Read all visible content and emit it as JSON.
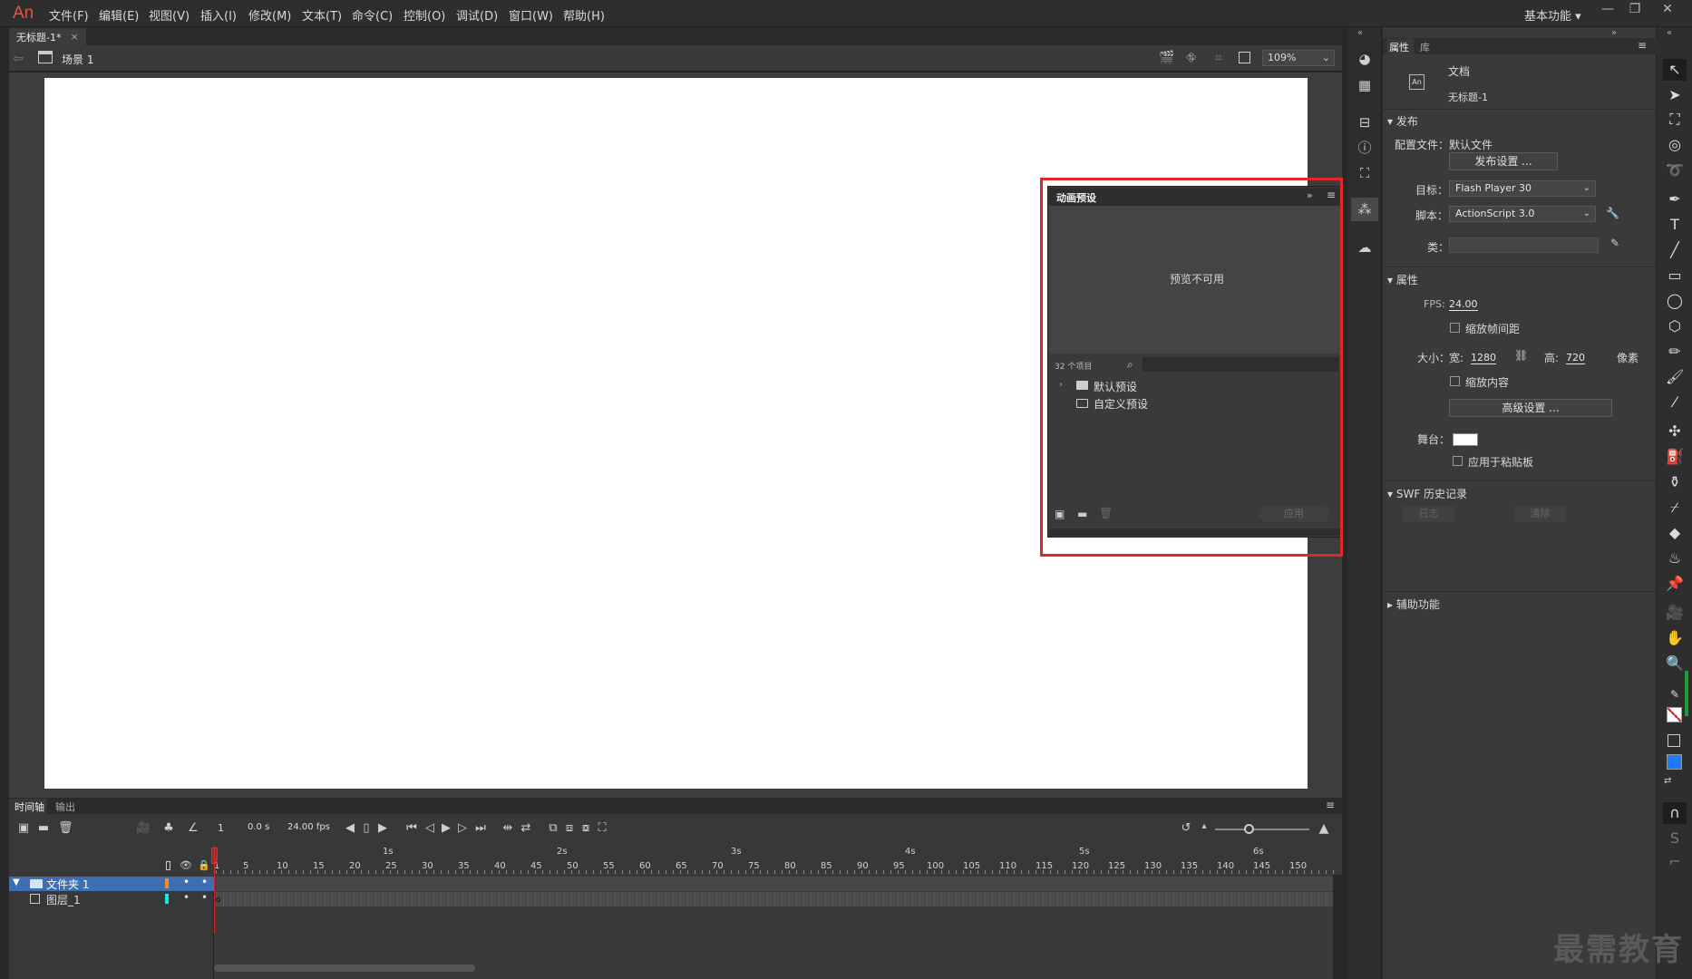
{
  "app": {
    "logo": "An",
    "workspace": "基本功能 ▾"
  },
  "menu": [
    {
      "id": "file",
      "label": "文件(F)"
    },
    {
      "id": "edit",
      "label": "编辑(E)"
    },
    {
      "id": "view",
      "label": "视图(V)"
    },
    {
      "id": "insert",
      "label": "插入(I)"
    },
    {
      "id": "modify",
      "label": "修改(M)"
    },
    {
      "id": "text",
      "label": "文本(T)"
    },
    {
      "id": "commands",
      "label": "命令(C)"
    },
    {
      "id": "control",
      "label": "控制(O)"
    },
    {
      "id": "debug",
      "label": "调试(D)"
    },
    {
      "id": "window",
      "label": "窗口(W)"
    },
    {
      "id": "help",
      "label": "帮助(H)"
    }
  ],
  "document": {
    "tab_title": "无标题-1*",
    "close": "×"
  },
  "scene": {
    "label": "场景 1",
    "zoom": "109%"
  },
  "preset_panel": {
    "title": "动画预设",
    "preview_text": "预览不可用",
    "count": "32 个项目",
    "folders": [
      "默认预设",
      "自定义预设"
    ],
    "apply": "应用"
  },
  "properties": {
    "tab_props": "属性",
    "tab_library": "库",
    "doc_type": "文档",
    "doc_name": "无标题-1",
    "publish": {
      "header": "发布",
      "profile_label": "配置文件：",
      "profile_value": "默认文件",
      "settings_button": "发布设置 ...",
      "target_label": "目标：",
      "target_value": "Flash Player 30",
      "script_label": "脚本：",
      "script_value": "ActionScript 3.0",
      "class_label": "类："
    },
    "attributes": {
      "header": "属性",
      "fps_label": "FPS:",
      "fps_value": "24.00",
      "scale_spans": "缩放帧间距",
      "size_label": "大小：",
      "width_label": "宽:",
      "width_value": "1280",
      "height_label": "高:",
      "height_value": "720",
      "unit": "像素",
      "scale_content": "缩放内容",
      "advanced_button": "高级设置 ...",
      "stage_label": "舞台：",
      "stage_color": "#ffffff",
      "apply_pasteboard": "应用于粘贴板"
    },
    "swf_history": {
      "header": "SWF 历史记录",
      "log": "日志",
      "clear": "清除"
    },
    "accessibility": {
      "header": "辅助功能"
    }
  },
  "timeline": {
    "tab_timeline": "时间轴",
    "tab_output": "输出",
    "current_frame": "1",
    "time": "0.0 s",
    "fps": "24.00 fps",
    "seconds": [
      "1s",
      "2s",
      "3s",
      "4s",
      "5s",
      "6s"
    ],
    "frame_numbers": [
      "1",
      "5",
      "10",
      "15",
      "20",
      "25",
      "30",
      "35",
      "40",
      "45",
      "50",
      "55",
      "60",
      "65",
      "70",
      "75",
      "80",
      "85",
      "90",
      "95",
      "100",
      "105",
      "110",
      "115",
      "120",
      "125",
      "130",
      "135",
      "140",
      "145",
      "150"
    ],
    "layers": [
      {
        "name": "文件夹 1",
        "color": "#ff8a1f",
        "type": "folder"
      },
      {
        "name": "图层_1",
        "color": "#1fe4f0",
        "type": "layer"
      }
    ]
  },
  "colors": {
    "accent_red": "#e1262d",
    "selection_blue": "#3f6fb0",
    "fill_blue": "#1e7bff"
  },
  "watermark": "最需教育"
}
